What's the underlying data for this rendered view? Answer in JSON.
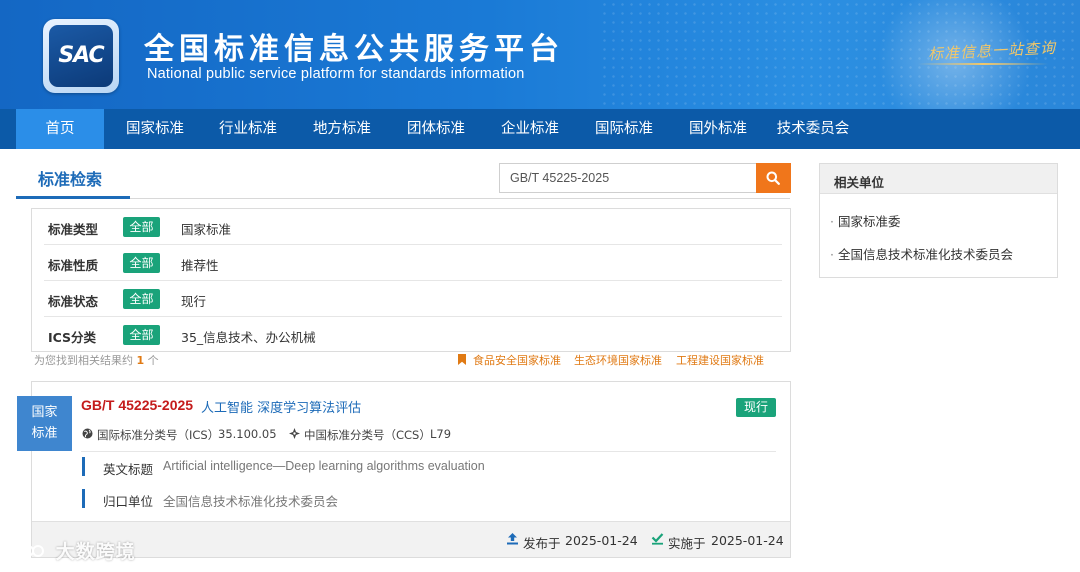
{
  "header": {
    "logo_text": "SAC",
    "title": "全国标准信息公共服务平台",
    "subtitle": "National public service platform  for standards information",
    "slogan": "标准信息一站查询"
  },
  "nav": {
    "items": [
      {
        "label": "首页",
        "active": true
      },
      {
        "label": "国家标准"
      },
      {
        "label": "行业标准"
      },
      {
        "label": "地方标准"
      },
      {
        "label": "团体标准"
      },
      {
        "label": "企业标准"
      },
      {
        "label": "国际标准"
      },
      {
        "label": "国外标准"
      },
      {
        "label": "技术委员会"
      }
    ]
  },
  "search": {
    "tab_label": "标准检索",
    "query": "GB/T 45225-2025",
    "button_icon": "search-icon"
  },
  "filters": [
    {
      "label": "标准类型",
      "badge": "全部",
      "value": "国家标准"
    },
    {
      "label": "标准性质",
      "badge": "全部",
      "value": "推荐性"
    },
    {
      "label": "标准状态",
      "badge": "全部",
      "value": "现行"
    },
    {
      "label": "ICS分类",
      "badge": "全部",
      "value": "35_信息技术、办公机械"
    }
  ],
  "results_summary": {
    "prefix": "为您找到相关结果约",
    "count": "1",
    "suffix": "个"
  },
  "quick_links": [
    "食品安全国家标准",
    "生态环境国家标准",
    "工程建设国家标准"
  ],
  "result": {
    "tag": [
      "国家",
      "标准"
    ],
    "code": "GB/T 45225-2025",
    "title": "人工智能 深度学习算法评估",
    "status": "现行",
    "ics_label": "国际标准分类号（ICS）",
    "ics_value": "35.100.05",
    "ccs_label": "中国标准分类号（CCS）",
    "ccs_value": "L79",
    "english_title_label": "英文标题",
    "english_title": "Artificial intelligence—Deep learning algorithms evaluation",
    "owner_label": "归口单位",
    "owner": "全国信息技术标准化技术委员会",
    "published_label": "发布于",
    "published_date": "2025-01-24",
    "effective_label": "实施于",
    "effective_date": "2025-01-24"
  },
  "side_panel": {
    "title": "相关单位",
    "items": [
      "国家标准委",
      "全国信息技术标准化技术委员会"
    ]
  },
  "watermark": "大数跨境",
  "colors": {
    "nav_bg": "#0c5aa8",
    "nav_active": "#2b8ee8",
    "accent_blue": "#1d6bb8",
    "badge_green": "#1aa37a",
    "search_orange": "#f0761b",
    "code_red": "#c41b1b",
    "link_orange": "#e07a14"
  }
}
